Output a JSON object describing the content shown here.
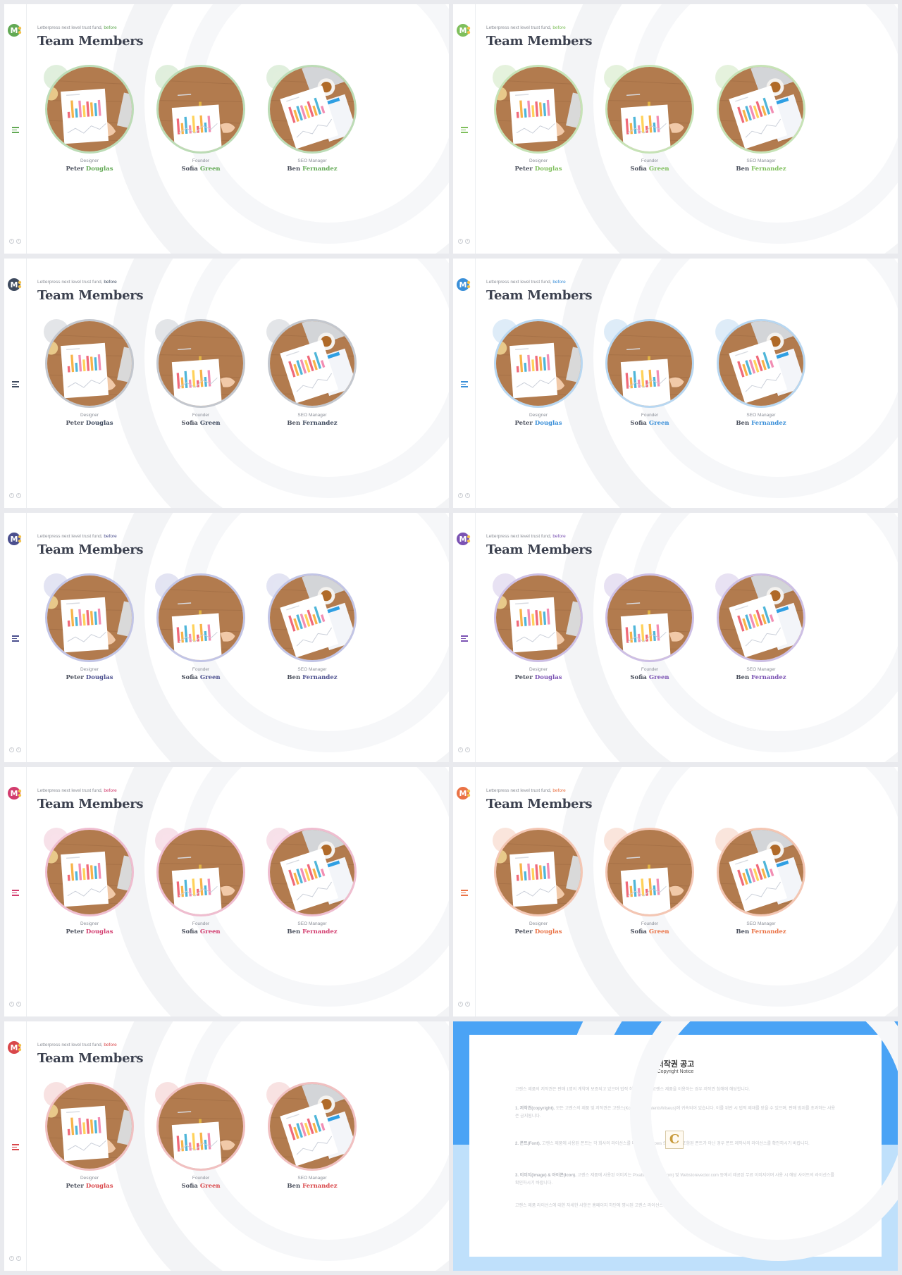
{
  "slides": [
    {
      "accent": "#62a954",
      "light": "#bcdcb6",
      "member_color_from": "last_only",
      "subtitle": "Letterpress next level trust fund,",
      "subtitle_accent": "before",
      "title": "Team Members"
    },
    {
      "accent": "#7fbf5c",
      "light": "#c6e3b6",
      "subtitle": "Letterpress next level trust fund,",
      "subtitle_accent": "before",
      "title": "Team Members"
    },
    {
      "accent": "#3e4a5e",
      "light": "#c3c7ce",
      "subtitle": "Letterpress next level trust fund,",
      "subtitle_accent": "before",
      "title": "Team Members"
    },
    {
      "accent": "#3a8fd8",
      "light": "#b8d7f1",
      "subtitle": "Letterpress next level trust fund,",
      "subtitle_accent": "before",
      "title": "Team Members"
    },
    {
      "accent": "#4b4f8e",
      "light": "#c2c5e6",
      "subtitle": "Letterpress next level trust fund,",
      "subtitle_accent": "before",
      "title": "Team Members"
    },
    {
      "accent": "#7b53b3",
      "light": "#cdbfe5",
      "subtitle": "Letterpress next level trust fund,",
      "subtitle_accent": "before",
      "title": "Team Members"
    },
    {
      "accent": "#d23c6e",
      "light": "#efbdd0",
      "subtitle": "Letterpress next level trust fund,",
      "subtitle_accent": "before",
      "title": "Team Members"
    },
    {
      "accent": "#ea7346",
      "light": "#f4c6b3",
      "subtitle": "Letterpress next level trust fund,",
      "subtitle_accent": "before",
      "title": "Team Members"
    },
    {
      "accent": "#d9474a",
      "light": "#f1c0c1",
      "subtitle": "Letterpress next level trust fund,",
      "subtitle_accent": "before",
      "title": "Team Members"
    }
  ],
  "members": [
    {
      "role": "Designer",
      "first": "Peter",
      "last": "Douglas"
    },
    {
      "role": "Founder",
      "first": "Sofia",
      "last": "Green"
    },
    {
      "role": "SEO Manager",
      "first": "Ben",
      "last": "Fernandez"
    }
  ],
  "copyright": {
    "title": "저작권 공고",
    "subtitle": "Copyright Notice",
    "para1": "고렌스 제품의 저작권은 판매 1명의 계약에 보증되고 있으며 법적 허가 없이 인 고렌스 제품을 이용하는 경우 저작권 침해에 해당합니다.",
    "para2_head": "1. 저작권(copyright).",
    "para2": "모든 고렌스의 제품 및 저작권은 고렌스(Ko-Lens)(ContentsWiseus)에 귀속되어 있습니다. 이를 위반 시 법적 제재를 받을 수 있으며, 판매 범위를 초과하는 사용은 금지됩니다.",
    "para3_head": "2. 폰트(Font).",
    "para3": "고렌스 제품에 사용된 폰트는 각 회사의 라이선스를 따르며 Windows System에 포함된 폰트가 아닌 경우 폰트 제작사의 라이선스를 확인하시기 바랍니다.",
    "para4_head": "3. 이미지(Image) & 아이콘(Icon).",
    "para4": "고렌스 제품에 사용된 이미지는 Pixabay(pixabay.com) 및 Webstorevector.com 등에서 제공된 무료 이미지이며 사용 시 해당 사이트의 라이선스를 확인하시기 바랍니다.",
    "para5": "고렌스 제품 라이선스에 대한 자세한 사항은 홈페이지 하단에 명시된 고렌스 라이선스를 참고하세요.",
    "logo_letter": "C"
  }
}
